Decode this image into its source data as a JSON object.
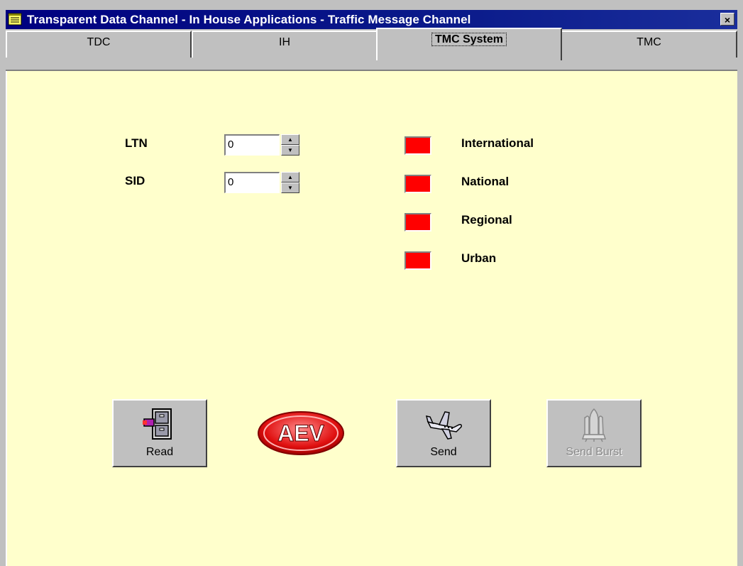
{
  "window": {
    "title": "Transparent Data Channel - In House Applications - Traffic Message Channel",
    "close_label": "×"
  },
  "tabs": [
    {
      "label": "TDC",
      "active": false
    },
    {
      "label": "IH",
      "active": false
    },
    {
      "label": "TMC System",
      "active": true
    },
    {
      "label": "TMC",
      "active": false
    }
  ],
  "form": {
    "ltn": {
      "label": "LTN",
      "value": "0"
    },
    "sid": {
      "label": "SID",
      "value": "0"
    }
  },
  "indicators": [
    {
      "label": "International",
      "color": "#ff0000"
    },
    {
      "label": "National",
      "color": "#ff0000"
    },
    {
      "label": "Regional",
      "color": "#ff0000"
    },
    {
      "label": "Urban",
      "color": "#ff0000"
    }
  ],
  "buttons": {
    "read": "Read",
    "send": "Send",
    "send_burst": "Send Burst"
  },
  "logo": {
    "text": "AEV"
  },
  "icons": {
    "app": "notepad-icon",
    "read": "file-cabinet-icon",
    "send": "airplane-icon",
    "send_burst": "space-shuttle-icon"
  },
  "colors": {
    "titlebar": "#000080",
    "panel_bg": "#ffffcc",
    "led_red": "#ff0000",
    "chrome": "#c0c0c0"
  }
}
